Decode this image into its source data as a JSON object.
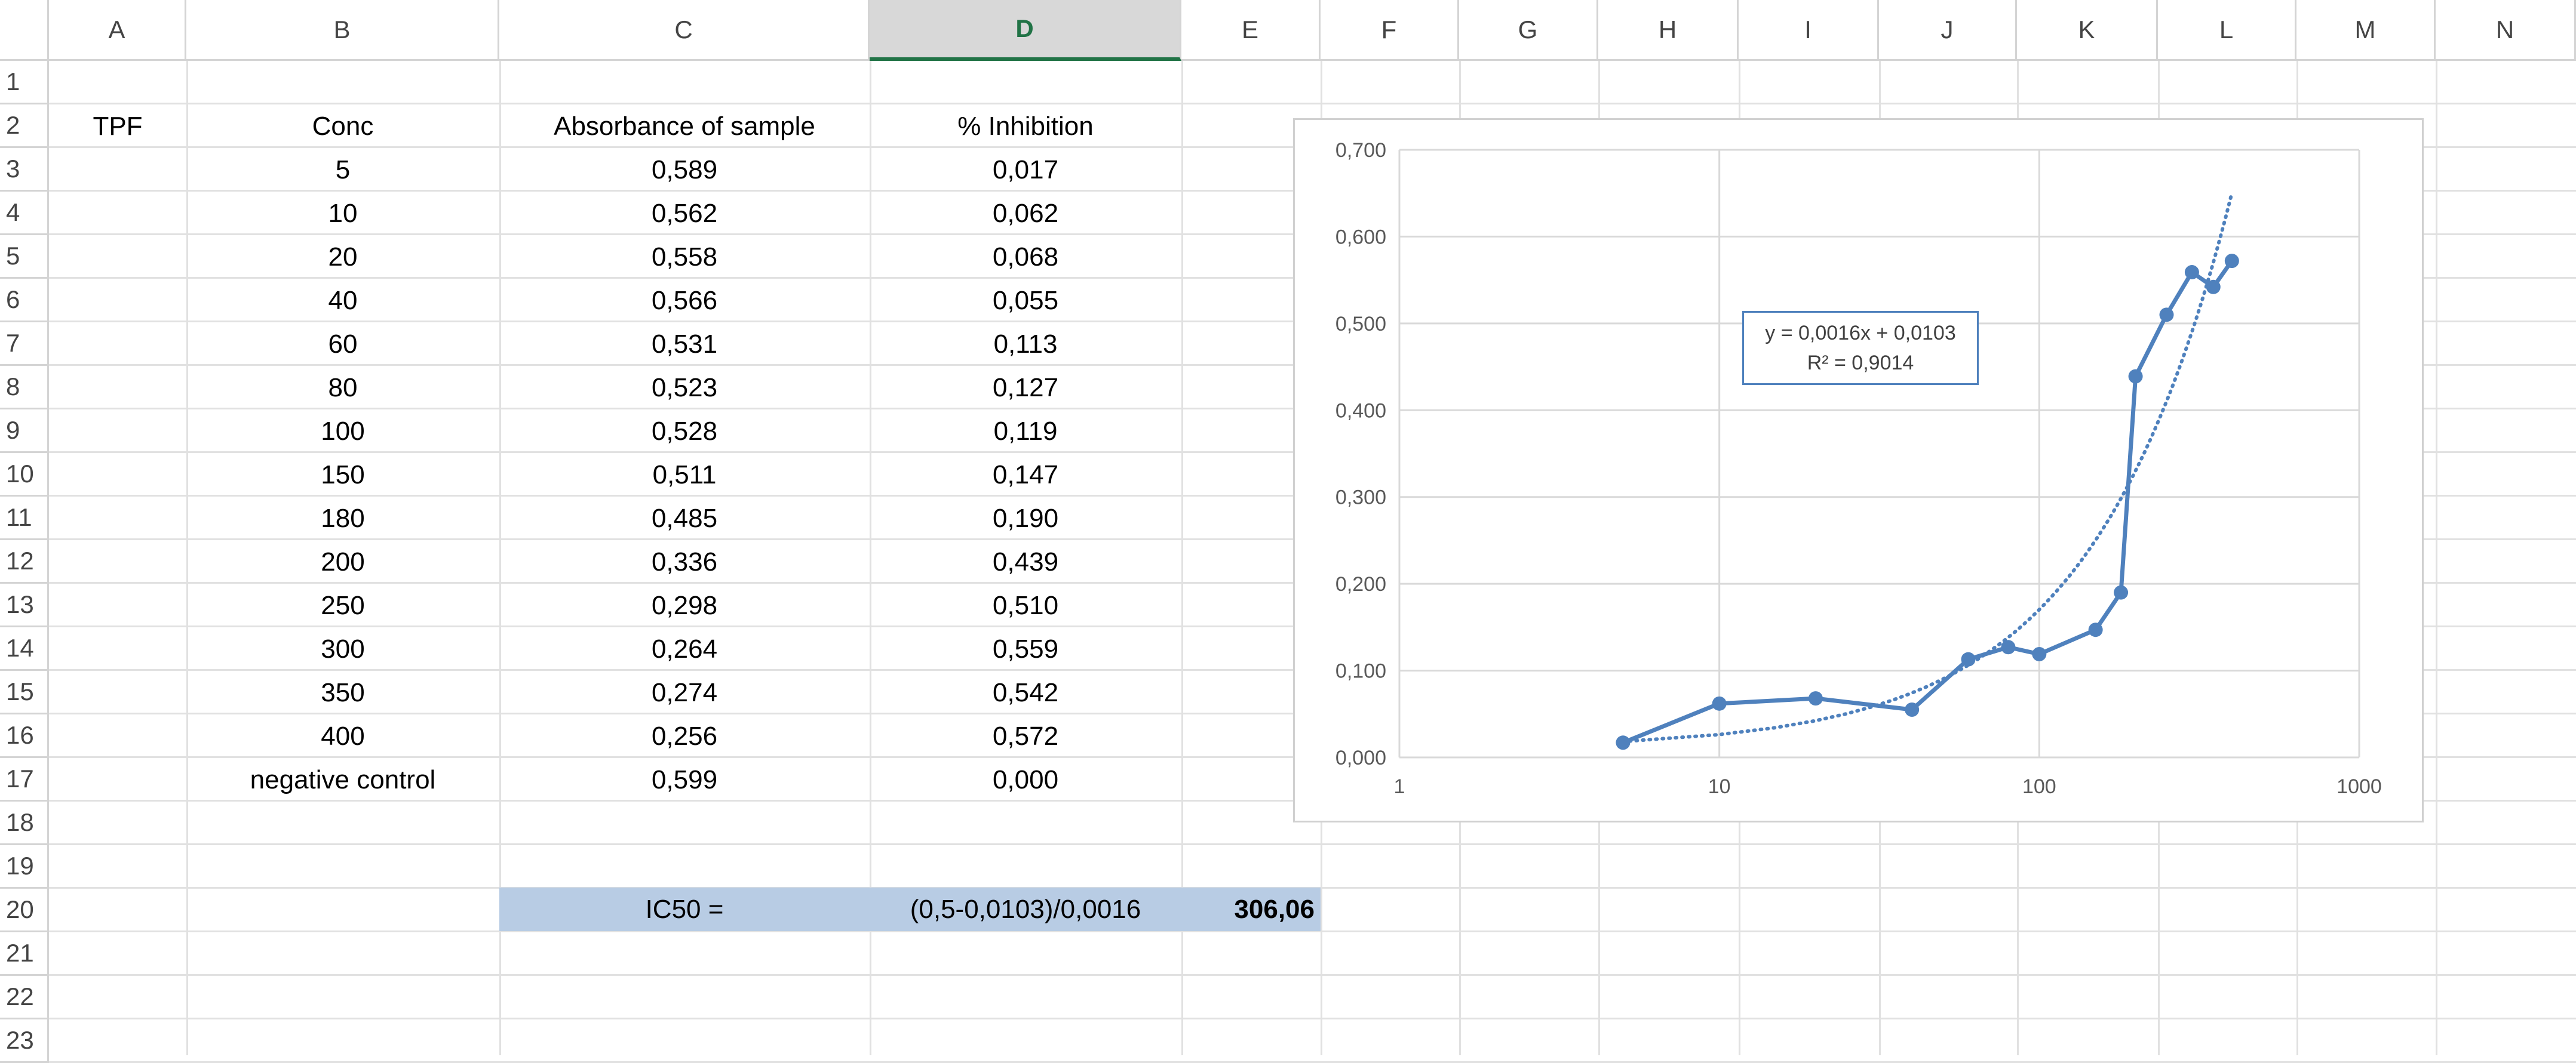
{
  "sheet": {
    "columns": [
      "A",
      "B",
      "C",
      "D",
      "E",
      "F",
      "G",
      "H",
      "I",
      "J",
      "K",
      "L",
      "M",
      "N"
    ],
    "selected_column": "D",
    "rows": [
      "1",
      "2",
      "3",
      "4",
      "5",
      "6",
      "7",
      "8",
      "9",
      "10",
      "11",
      "12",
      "13",
      "14",
      "15",
      "16",
      "17",
      "18",
      "19",
      "20",
      "21",
      "22",
      "23"
    ]
  },
  "table": {
    "label_a": "TPF",
    "headers": [
      "Conc",
      "Absorbance of sample",
      "% Inhibition"
    ],
    "rows": [
      [
        "5",
        "0,589",
        "0,017"
      ],
      [
        "10",
        "0,562",
        "0,062"
      ],
      [
        "20",
        "0,558",
        "0,068"
      ],
      [
        "40",
        "0,566",
        "0,055"
      ],
      [
        "60",
        "0,531",
        "0,113"
      ],
      [
        "80",
        "0,523",
        "0,127"
      ],
      [
        "100",
        "0,528",
        "0,119"
      ],
      [
        "150",
        "0,511",
        "0,147"
      ],
      [
        "180",
        "0,485",
        "0,190"
      ],
      [
        "200",
        "0,336",
        "0,439"
      ],
      [
        "250",
        "0,298",
        "0,510"
      ],
      [
        "300",
        "0,264",
        "0,559"
      ],
      [
        "350",
        "0,274",
        "0,542"
      ],
      [
        "400",
        "0,256",
        "0,572"
      ],
      [
        "negative control",
        "0,599",
        "0,000"
      ]
    ]
  },
  "ic50": {
    "label": "IC50 =",
    "formula": "(0,5-0,0103)/0,0016",
    "result": "306,06"
  },
  "colors": {
    "series": "#4f81bd",
    "fill": "#b8cce4",
    "grid": "#d9d9d9",
    "selected_header": "#217346"
  },
  "chart_data": {
    "type": "line",
    "x_scale": "log",
    "x": [
      5,
      10,
      20,
      40,
      60,
      80,
      100,
      150,
      180,
      200,
      250,
      300,
      350,
      400
    ],
    "series": [
      {
        "values": [
          0.017,
          0.062,
          0.068,
          0.055,
          0.113,
          0.127,
          0.119,
          0.147,
          0.19,
          0.439,
          0.51,
          0.559,
          0.542,
          0.572
        ]
      }
    ],
    "trendline": {
      "type": "linear",
      "slope": 0.0016,
      "intercept": 0.0103,
      "style": "dotted"
    },
    "xlim": [
      1,
      1000
    ],
    "ylim": [
      0,
      0.7
    ],
    "x_ticks": [
      "1",
      "10",
      "100",
      "1000"
    ],
    "y_ticks": [
      "0,000",
      "0,100",
      "0,200",
      "0,300",
      "0,400",
      "0,500",
      "0,600",
      "0,700"
    ],
    "grid": true,
    "equation": "y = 0,0016x + 0,0103",
    "r_squared": "R² = 0,9014"
  }
}
